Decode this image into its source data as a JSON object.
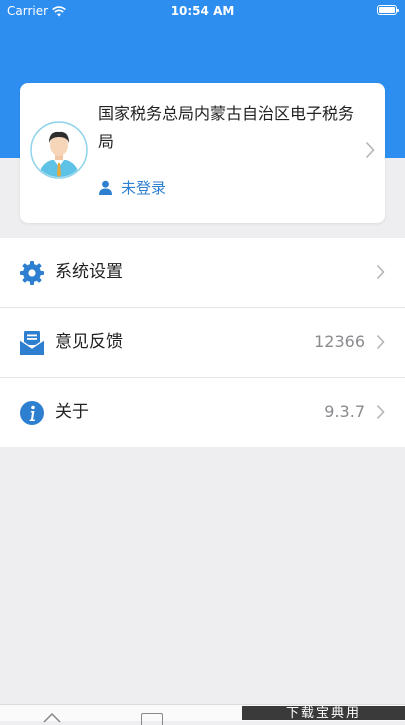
{
  "status_bar": {
    "carrier": "Carrier",
    "time": "10:54 AM",
    "icons": [
      "wifi-icon",
      "battery-icon"
    ]
  },
  "colors": {
    "brand_blue": "#2e8ef0",
    "link_blue": "#2f7fd1",
    "page_bg": "#eeeef1"
  },
  "profile": {
    "org_name": "国家税务总局内蒙古自治区电子税务局",
    "login_status": "未登录",
    "icons": [
      "avatar",
      "user-icon",
      "chevron-right-icon"
    ]
  },
  "menu": {
    "items": [
      {
        "label": "系统设置",
        "value": "",
        "icon": "settings-gear-icon"
      },
      {
        "label": "意见反馈",
        "value": "12366",
        "icon": "feedback-mail-icon"
      },
      {
        "label": "关于",
        "value": "9.3.7",
        "icon": "info-icon"
      }
    ]
  },
  "watermark": {
    "text": "下载宝典用"
  }
}
